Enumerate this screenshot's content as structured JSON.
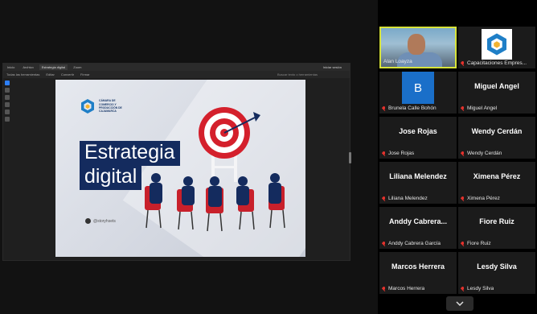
{
  "window": {
    "tabs": [
      "Inicio",
      "Archivo",
      "Estrategia digital",
      "Zoom"
    ],
    "share_label": "Iniciar sesión",
    "menu": [
      "Todas las herramientas",
      "Editar",
      "Convertir",
      "Firmar"
    ],
    "search_text": "Buscar texto o herramientas"
  },
  "slide": {
    "org_name": "CÁMARA DE COMERCIO Y PRODUCCIÓN DE CAJAMARCA",
    "title_line1": "Estrategia",
    "title_line2": "digital",
    "handle": "@storyhsets"
  },
  "participants": [
    {
      "display": "",
      "label": "Alan Loayza",
      "type": "video",
      "speaking": true
    },
    {
      "display": "",
      "label": "Capacitaciones Empres...",
      "type": "logo"
    },
    {
      "display": "B",
      "label": "Brunela Calle Bohón",
      "type": "avatar"
    },
    {
      "display": "Miguel Angel",
      "label": "Miguel Angel",
      "type": "name"
    },
    {
      "display": "Jose Rojas",
      "label": "Jose Rojas",
      "type": "name"
    },
    {
      "display": "Wendy Cerdán",
      "label": "Wendy Cerdán",
      "type": "name"
    },
    {
      "display": "Liliana Melendez",
      "label": "Liliana Melendez",
      "type": "name"
    },
    {
      "display": "Ximena Pérez",
      "label": "Ximena Pérez",
      "type": "name"
    },
    {
      "display": "Anddy Cabrera...",
      "label": "Anddy Cabrera García",
      "type": "name"
    },
    {
      "display": "Fiore Ruiz",
      "label": "Fiore Ruiz",
      "type": "name"
    },
    {
      "display": "Marcos Herrera",
      "label": "Marcos Herrera",
      "type": "name"
    },
    {
      "display": "Lesdy Silva",
      "label": "Lesdy Silva",
      "type": "name"
    }
  ],
  "colors": {
    "speaking_border": "#d7e33a",
    "muted_mic": "#e5322d",
    "slide_title_bg": "#142b5e",
    "target_red": "#d4202c",
    "chair_red": "#c8202b"
  },
  "icons": {
    "mic_muted": "mic-off-icon",
    "scroll_down": "chevron-down-icon"
  }
}
